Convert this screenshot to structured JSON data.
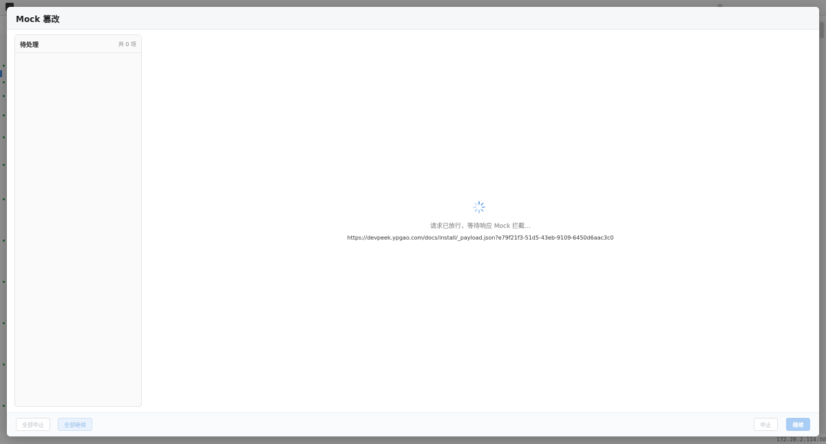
{
  "modal": {
    "title": "Mock 篡改",
    "pending": {
      "title": "待处理",
      "count": "共 0 项"
    },
    "loading": {
      "message": "请求已放行，等待响应 Mock 拦截…",
      "url": "https://devpeek.ypgao.com/docs/install/_payload.json?e79f21f3-51d5-43eb-9109-6450d6aac3c0"
    },
    "footer": {
      "abort_all_label": "全部中止",
      "continue_all_label": "全部继续",
      "abort_label": "中止",
      "continue_label": "继续"
    }
  },
  "background": {
    "status_text": "172.20.2.114:8888"
  },
  "colors": {
    "accent": "#4a90e2",
    "continue_disabled": "#a9cdf4",
    "overlay": "rgba(0,0,0,0.42)"
  },
  "icons": {
    "loading": "spinner-icon"
  }
}
